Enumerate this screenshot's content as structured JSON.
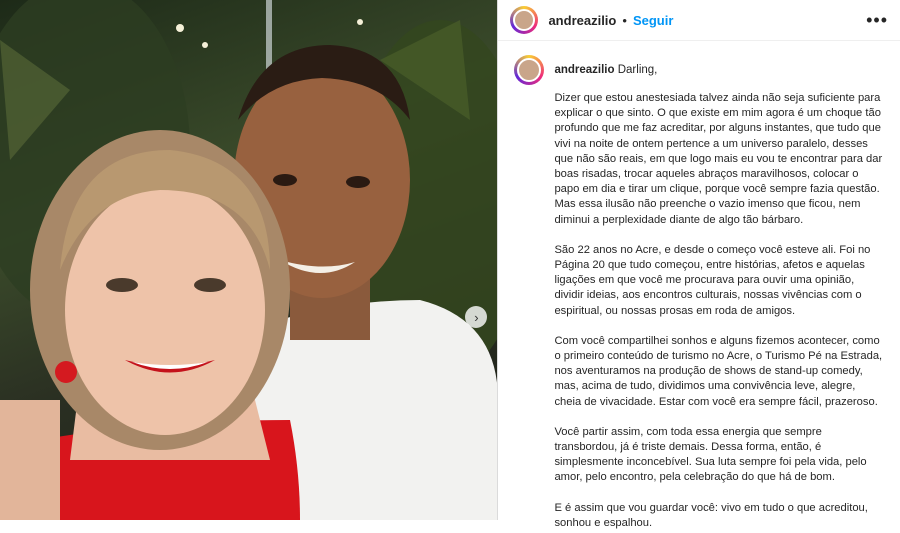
{
  "post": {
    "username": "andreazilio",
    "separator": "•",
    "follow_label": "Seguir",
    "more_label": "•••",
    "carousel_next": "›"
  },
  "caption": {
    "username": "andreazilio",
    "greeting": "Darling,",
    "paragraphs": [
      "Dizer que estou anestesiada talvez ainda não seja suficiente para explicar o que sinto. O que existe em mim agora é um choque tão profundo que me faz acreditar, por alguns instantes, que tudo que vivi na noite de ontem pertence a um universo paralelo, desses que não são reais, em que logo mais eu vou te encontrar para dar boas risadas, trocar aqueles abraços maravilhosos, colocar o papo em dia e tirar um clique, porque você sempre fazia questão. Mas essa ilusão não preenche o vazio imenso que ficou, nem diminui a perplexidade diante de algo tão bárbaro.",
      "São 22 anos no Acre, e desde o começo você esteve ali. Foi no Página 20 que tudo começou, entre histórias, afetos e aquelas ligações em que você me procurava para ouvir uma opinião, dividir ideias, aos encontros culturais, nossas vivências com o espiritual, ou nossas prosas em roda de amigos.",
      "Com você compartilhei sonhos e alguns fizemos acontecer, como o primeiro conteúdo de turismo no Acre, o Turismo Pé na Estrada, nos aventuramos na produção de shows de stand-up comedy, mas, acima de tudo, dividimos uma convivência leve, alegre, cheia de vivacidade. Estar com você era sempre fácil, prazeroso.",
      "Você partir assim, com toda essa energia que sempre transbordou, já é triste demais. Dessa forma, então, é simplesmente inconcebível. Sua luta sempre foi pela vida, pelo amor, pelo encontro, pela celebração do que há de bom.",
      "E é assim que vou guardar você: vivo em tudo o que acreditou, sonhou e espalhou."
    ]
  },
  "colors": {
    "follow": "#0095f6",
    "text": "#262626",
    "border": "#dbdbdb"
  },
  "icons": {
    "more": "more-options-icon",
    "next": "chevron-right-icon"
  }
}
